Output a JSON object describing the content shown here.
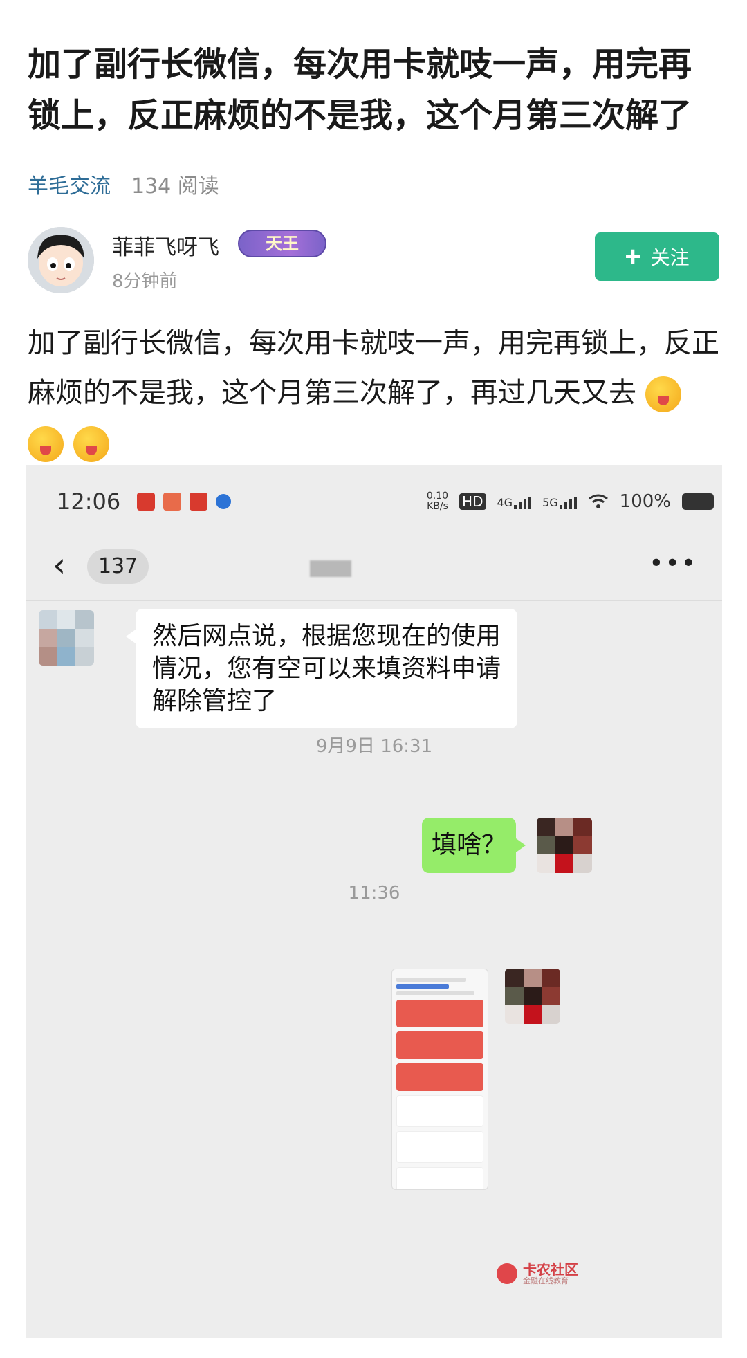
{
  "post": {
    "title": "加了副行长微信，每次用卡就吱一声，用完再锁上，反正麻烦的不是我，这个月第三次解了",
    "category": "羊毛交流",
    "reads": "134 阅读"
  },
  "author": {
    "name": "菲菲飞呀飞",
    "badge": "天王",
    "time": "8分钟前",
    "follow_label": "关注"
  },
  "content": {
    "text": "加了副行长微信，每次用卡就吱一声，用完再锁上，反正麻烦的不是我，这个月第三次解了，再过几天又去",
    "emoji_count": 3
  },
  "screenshot": {
    "status_bar": {
      "time": "12:06",
      "net_speed_value": "0.10",
      "net_speed_unit": "KB/s",
      "hd": "HD",
      "sig1": "4G",
      "sig2": "5G",
      "battery": "100%"
    },
    "chat": {
      "unread": "137",
      "messages": {
        "incoming": "然后网点说，根据您现在的使用情况，您有空可以来填资料申请解除管控了",
        "ts1": "9月9日 16:31",
        "outgoing": "填啥？",
        "ts2": "11:36"
      }
    },
    "watermark": {
      "main": "卡农社区",
      "sub": "金融在线教育"
    }
  }
}
